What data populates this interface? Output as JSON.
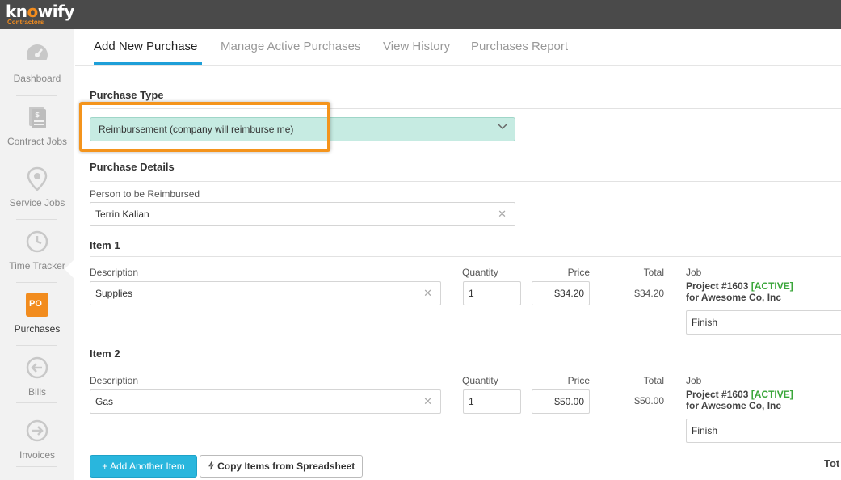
{
  "app": {
    "logo_text_pre": "kn",
    "logo_text_o": "o",
    "logo_text_post": "wify",
    "logo_sub": "Contractors"
  },
  "sidebar": {
    "items": [
      {
        "label": "Dashboard",
        "icon": "speedometer-icon"
      },
      {
        "label": "Contract Jobs",
        "icon": "document-icon"
      },
      {
        "label": "Service Jobs",
        "icon": "map-pin-icon"
      },
      {
        "label": "Time Tracker",
        "icon": "clock-icon"
      },
      {
        "label": "Purchases",
        "icon": "po-icon",
        "badge": "PO",
        "active": true
      },
      {
        "label": "Bills",
        "icon": "arrow-left-circle-icon"
      },
      {
        "label": "Invoices",
        "icon": "arrow-right-circle-icon"
      }
    ]
  },
  "tabs": [
    {
      "label": "Add New Purchase",
      "active": true
    },
    {
      "label": "Manage Active Purchases"
    },
    {
      "label": "View History"
    },
    {
      "label": "Purchases Report"
    }
  ],
  "purchase_type": {
    "title": "Purchase Type",
    "selected": "Reimbursement (company will reimburse me)"
  },
  "details": {
    "title": "Purchase Details",
    "person_label": "Person to be Reimbursed",
    "person_value": "Terrin Kalian"
  },
  "columns": {
    "description": "Description",
    "quantity": "Quantity",
    "price": "Price",
    "total": "Total",
    "job": "Job"
  },
  "items": [
    {
      "title": "Item 1",
      "description": "Supplies",
      "quantity": "1",
      "price": "$34.20",
      "total": "$34.20",
      "job_project": "Project #1603",
      "job_status": "[ACTIVE]",
      "job_client": "for Awesome Co, Inc",
      "phase": "Finish"
    },
    {
      "title": "Item 2",
      "description": "Gas",
      "quantity": "1",
      "price": "$50.00",
      "total": "$50.00",
      "job_project": "Project #1603",
      "job_status": "[ACTIVE]",
      "job_client": "for Awesome Co, Inc",
      "phase": "Finish"
    }
  ],
  "actions": {
    "add_item": "+ Add Another Item",
    "copy_items": "Copy Items from Spreadsheet",
    "total_label": "Tot"
  },
  "colors": {
    "accent": "#1e9fd8",
    "brand_orange": "#f28c1e",
    "select_bg": "#c6ebe2",
    "active_green": "#3aa63a"
  }
}
